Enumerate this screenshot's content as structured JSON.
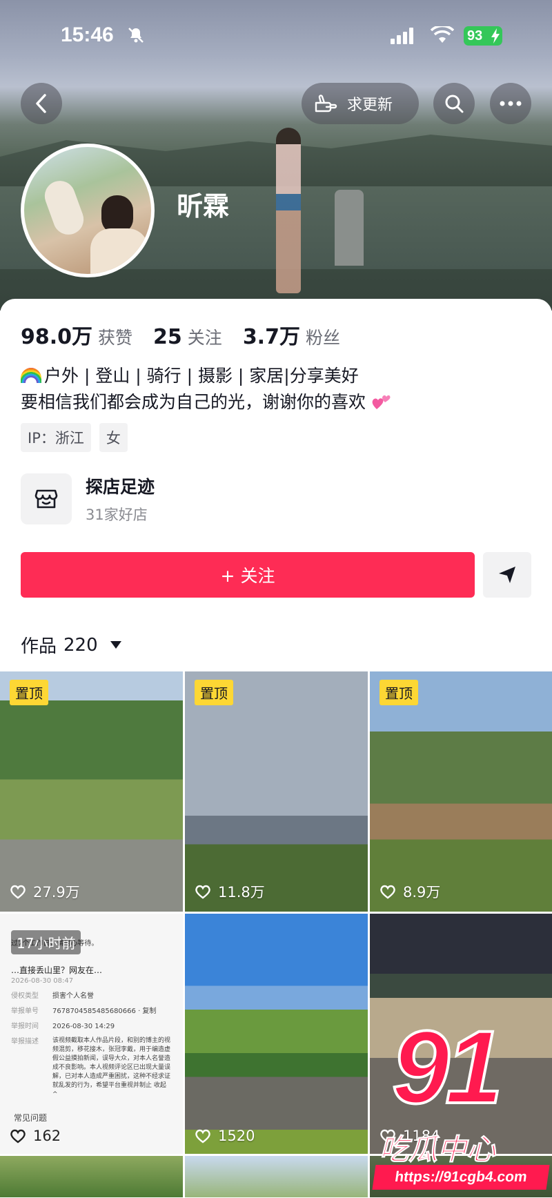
{
  "status_bar": {
    "time": "15:46",
    "battery": "93"
  },
  "header": {
    "update_label": "求更新"
  },
  "profile": {
    "name": "昕霖",
    "stats": [
      {
        "num": "98.0万",
        "label": "获赞"
      },
      {
        "num": "25",
        "label": "关注"
      },
      {
        "num": "3.7万",
        "label": "粉丝"
      }
    ],
    "bio_line1": "户外 | 登山 | 骑行 | 摄影 | 家居|分享美好",
    "bio_line2": "要相信我们都会成为自己的光，谢谢你的喜欢",
    "tags": [
      "IP：浙江",
      "女"
    ]
  },
  "shop": {
    "title": "探店足迹",
    "subtitle": "31家好店"
  },
  "actions": {
    "follow_label": "+ 关注"
  },
  "works": {
    "label": "作品",
    "count": "220"
  },
  "grid": {
    "pin_label": "置顶",
    "items": [
      {
        "likes": "27.9万"
      },
      {
        "likes": "11.8万"
      },
      {
        "likes": "8.9万"
      },
      {
        "likes": "162",
        "time_badge": "17小时前"
      },
      {
        "likes": "1520"
      },
      {
        "likes": "1184"
      }
    ],
    "doc": {
      "top": "过7个工作日，请耐心等待。",
      "title": "…直接丢山里？网友在…",
      "date1": "2026-08-30 08:47",
      "rows": [
        {
          "k": "侵权类型",
          "v": "损害个人名誉"
        },
        {
          "k": "举报单号",
          "v": "7678704585485680666 · 复制"
        },
        {
          "k": "举报时间",
          "v": "2026-08-30 14:29"
        },
        {
          "k": "举报描述",
          "v": "该视频截取本人作品片段，和别的博主的视频混剪，移花接木，张冠李戴，用于编造虚假公益摸拍新闻，误导大众，对本人名誉造成不良影响。本人视频评论区已出现大量误解，已对本人造成严重困扰，这种不经求证就乱发的行为，希望平台重视并制止 收起 ^"
        }
      ],
      "footer": "常见问题"
    }
  },
  "watermark": {
    "logo": "91",
    "cn": "吃瓜中心",
    "url": "https://91cgb4.com"
  },
  "colors": {
    "accent": "#fe2c55",
    "pin": "#fdd734"
  }
}
